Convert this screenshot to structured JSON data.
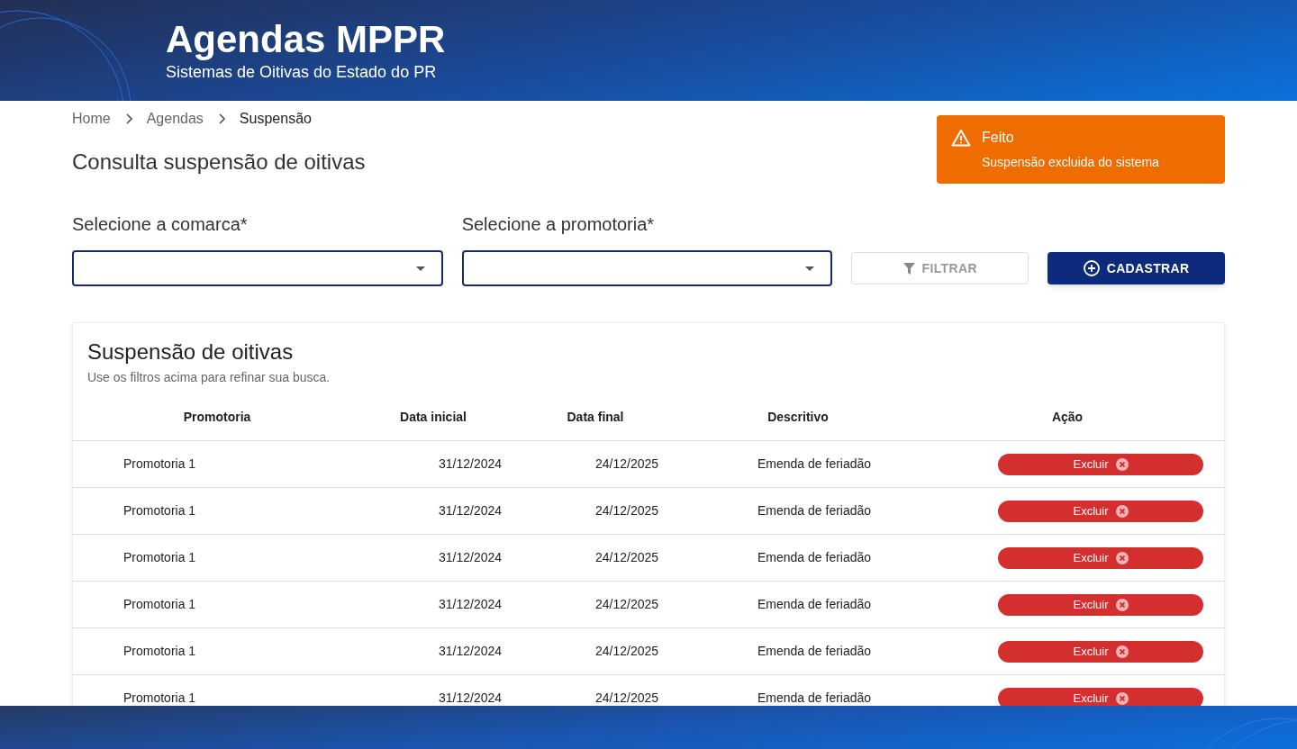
{
  "header": {
    "title": "Agendas MPPR",
    "subtitle": "Sistemas de Oitivas do Estado do PR"
  },
  "breadcrumb": [
    {
      "label": "Home",
      "current": false
    },
    {
      "label": "Agendas",
      "current": false
    },
    {
      "label": "Suspensão",
      "current": true
    }
  ],
  "page_title": "Consulta suspensão de oitivas",
  "toast": {
    "title": "Feito",
    "message": "Suspensão excluida do sistema"
  },
  "filters": [
    {
      "label": "Selecione a comarca*"
    },
    {
      "label": "Selecione a promotoria*"
    }
  ],
  "buttons": [
    {
      "label": "FILTRAR",
      "kind": "filter",
      "disabled": true
    },
    {
      "label": "CADASTRAR",
      "kind": "add",
      "disabled": false
    }
  ],
  "table": {
    "title": "Suspensão de oitivas",
    "subtitle": "Use os filtros acima para refinar sua busca.",
    "columns": [
      "Promotoria",
      "Data inicial",
      "Data final",
      "Descritivo",
      "Ação"
    ],
    "rows": [
      {
        "promotoria": "Promotoria 1",
        "inicial": "31/12/2024",
        "final": "24/12/2025",
        "descritivo": "Emenda de feriadão",
        "action": "Excluir"
      },
      {
        "promotoria": "Promotoria 1",
        "inicial": "31/12/2024",
        "final": "24/12/2025",
        "descritivo": "Emenda de feriadão",
        "action": "Excluir"
      },
      {
        "promotoria": "Promotoria 1",
        "inicial": "31/12/2024",
        "final": "24/12/2025",
        "descritivo": "Emenda de feriadão",
        "action": "Excluir"
      },
      {
        "promotoria": "Promotoria 1",
        "inicial": "31/12/2024",
        "final": "24/12/2025",
        "descritivo": "Emenda de feriadão",
        "action": "Excluir"
      },
      {
        "promotoria": "Promotoria 1",
        "inicial": "31/12/2024",
        "final": "24/12/2025",
        "descritivo": "Emenda de feriadão",
        "action": "Excluir"
      },
      {
        "promotoria": "Promotoria 1",
        "inicial": "31/12/2024",
        "final": "24/12/2025",
        "descritivo": "Emenda de feriadão",
        "action": "Excluir"
      }
    ]
  }
}
